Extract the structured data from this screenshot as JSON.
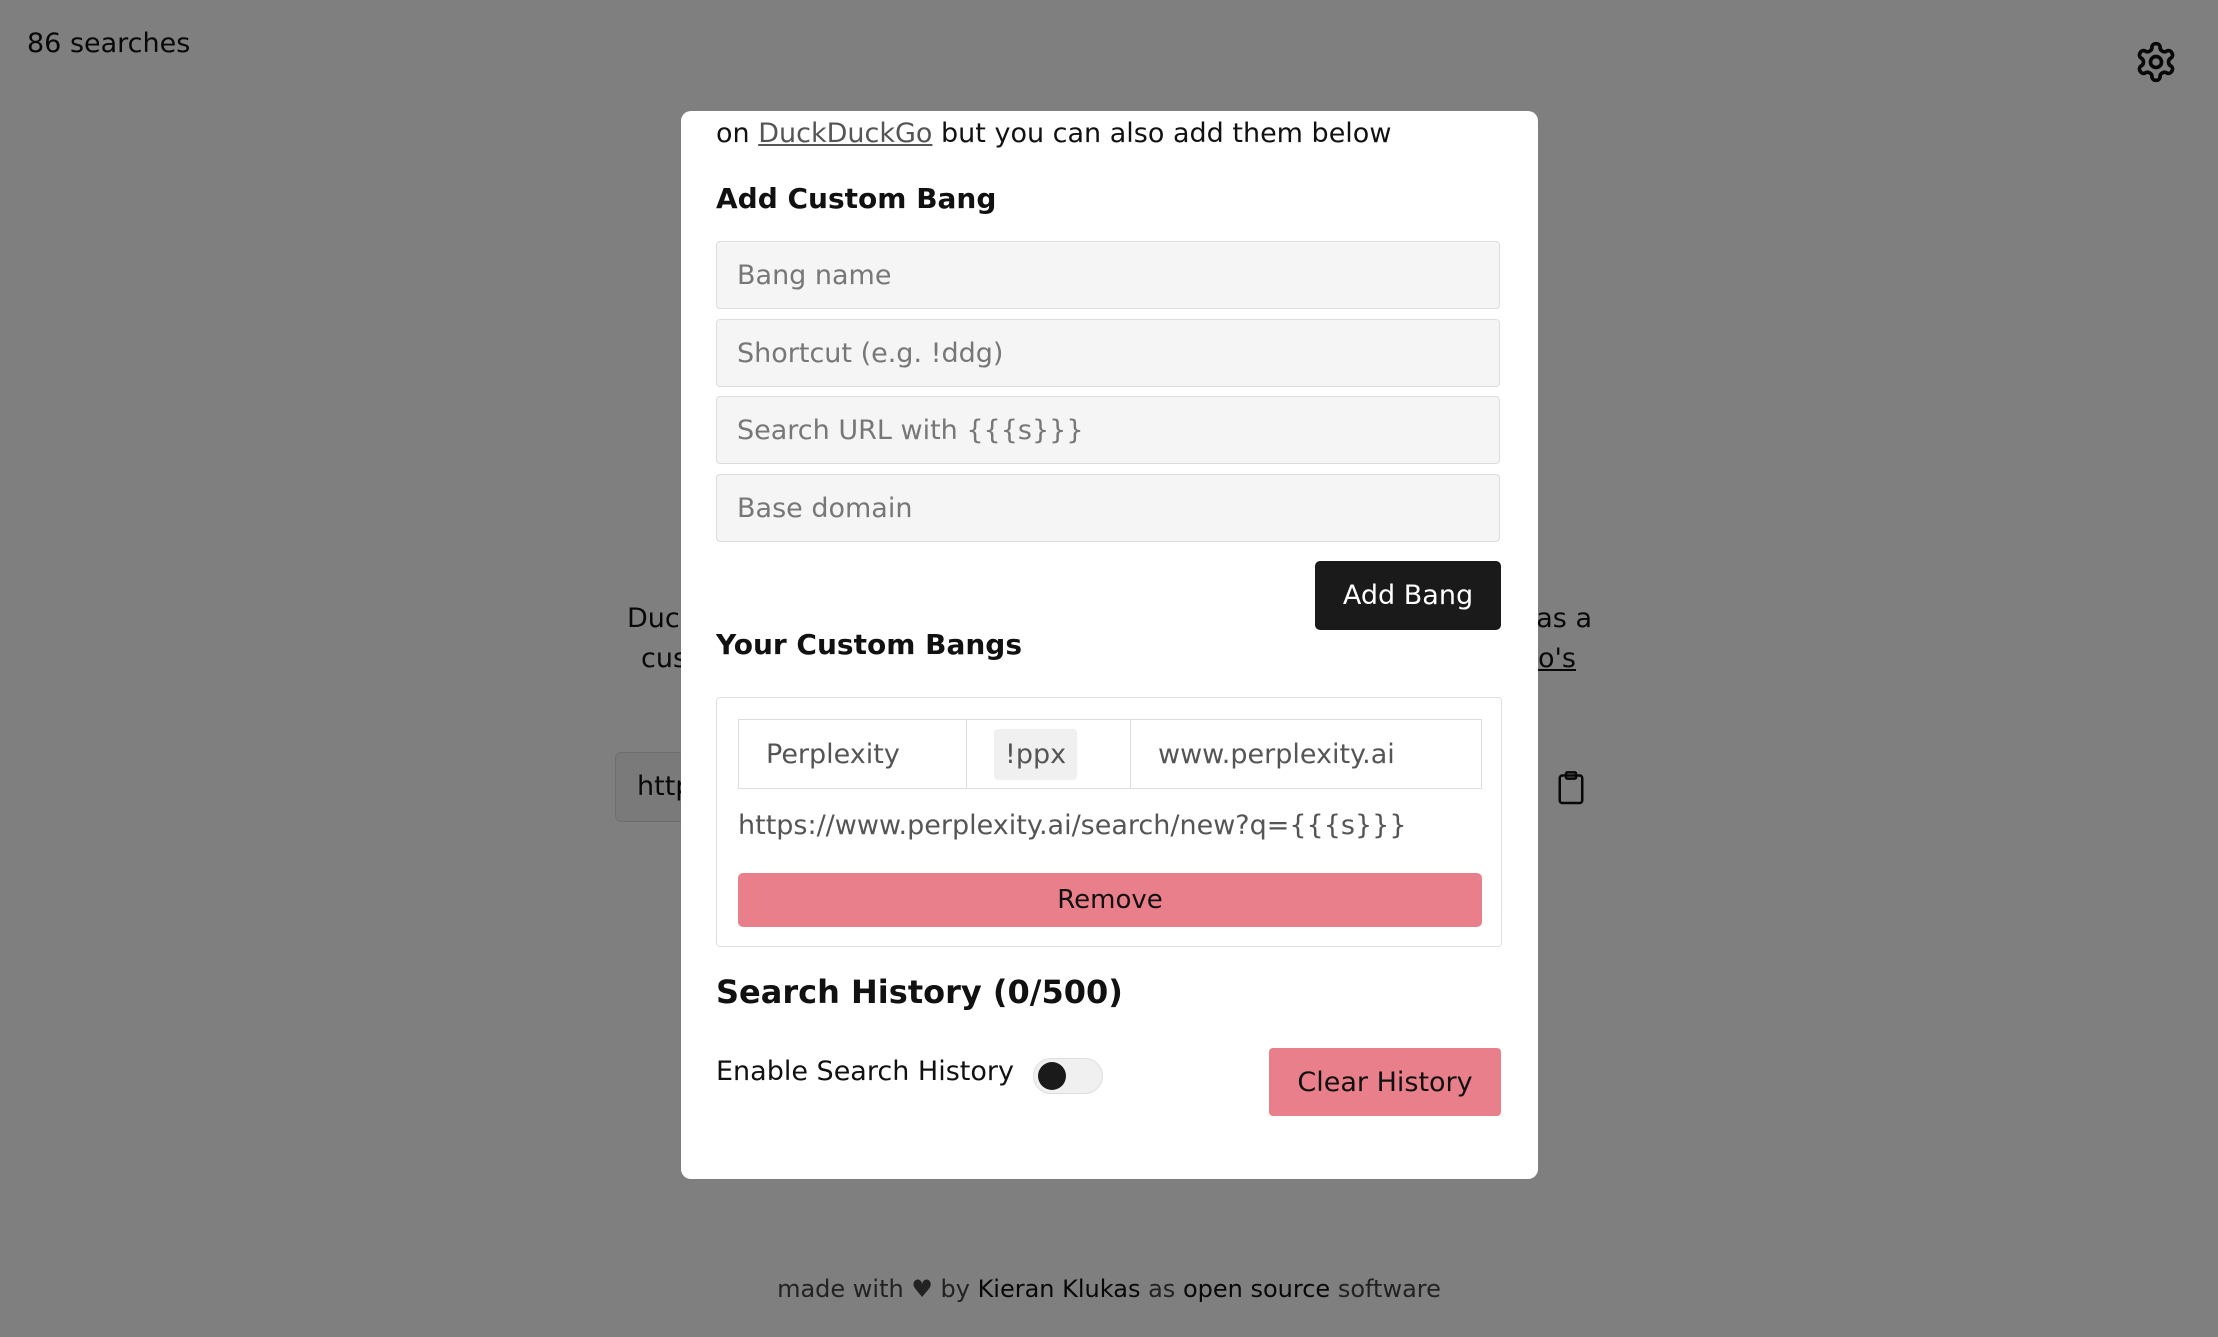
{
  "header": {
    "search_count": "86 searches"
  },
  "background": {
    "line1_left": "Duc",
    "line1_right": "as a",
    "line2_left": "cus",
    "line2_right": "o's",
    "url_fragment": "http"
  },
  "footer": {
    "prefix": "made with ♥ by",
    "author": "Kieran Klukas",
    "middle": "as",
    "link": "open source",
    "suffix": "software"
  },
  "modal": {
    "intro_prefix": "on",
    "intro_link": "DuckDuckGo",
    "intro_suffix": "but you can also add them below",
    "add_section_title": "Add Custom Bang",
    "fields": {
      "name_placeholder": "Bang name",
      "shortcut_placeholder": "Shortcut (e.g. !ddg)",
      "url_placeholder": "Search URL with {{{s}}}",
      "domain_placeholder": "Base domain"
    },
    "add_button": "Add Bang",
    "custom_section_title": "Your Custom Bangs",
    "bangs": [
      {
        "name": "Perplexity",
        "shortcut": "!ppx",
        "domain": "www.perplexity.ai",
        "url": "https://www.perplexity.ai/search/new?q={{{s}}}",
        "remove_label": "Remove"
      }
    ],
    "history_title": "Search History (0/500)",
    "history_toggle_label": "Enable Search History",
    "history_enabled": false,
    "clear_button": "Clear History"
  },
  "colors": {
    "overlay": "rgba(0,0,0,0.5)",
    "danger": "#e97f8a",
    "primary_button": "#1a1a1a"
  }
}
